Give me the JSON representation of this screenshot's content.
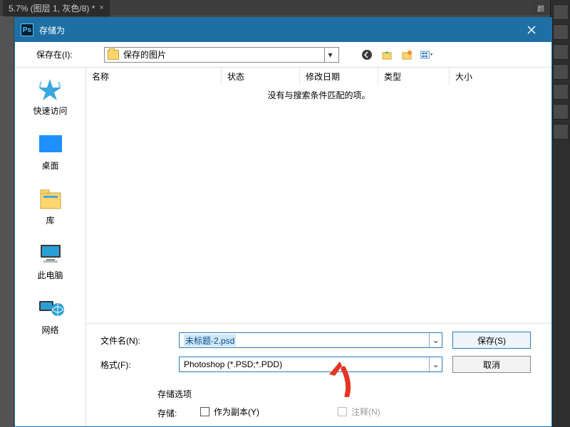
{
  "app": {
    "tab_title": "5.7% (图层 1, 灰色/8) *",
    "right_tabs": [
      "颜"
    ]
  },
  "dialog": {
    "title": "存储为",
    "save_in_label": "保存在(I):",
    "save_in_value": "保存的图片",
    "columns": {
      "name": "名称",
      "status": "状态",
      "modified": "修改日期",
      "type": "类型",
      "size": "大小"
    },
    "empty_message": "没有与搜索条件匹配的项。",
    "places": {
      "quick_access": "快速访问",
      "desktop": "桌面",
      "libraries": "库",
      "this_pc": "此电脑",
      "network": "网络"
    },
    "filename_label": "文件名(N):",
    "filename_value": "未标题-2.psd",
    "format_label": "格式(F):",
    "format_value": "Photoshop (*.PSD;*.PDD)",
    "save_btn": "保存(S)",
    "cancel_btn": "取消",
    "storage_options": "存储选项",
    "storage_label": "存储:",
    "as_copy": "作为副本(Y)",
    "annotations": "注释(N)"
  }
}
